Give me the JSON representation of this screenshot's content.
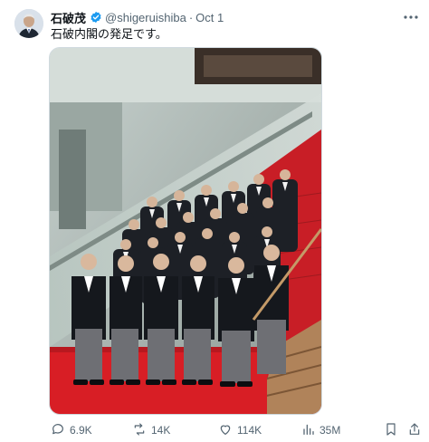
{
  "post": {
    "author_name": "石破茂",
    "handle": "@shigeruishiba",
    "separator": "·",
    "date": "Oct 1",
    "text": "石破内閣の発足です。"
  },
  "media": {
    "icon": "photo"
  },
  "actions": {
    "replies": "6.9K",
    "reposts": "14K",
    "likes": "114K",
    "views": "35M"
  },
  "colors": {
    "verified": "#1d9bf0",
    "secondary_text": "#536471",
    "carpet": "#d81e25"
  }
}
